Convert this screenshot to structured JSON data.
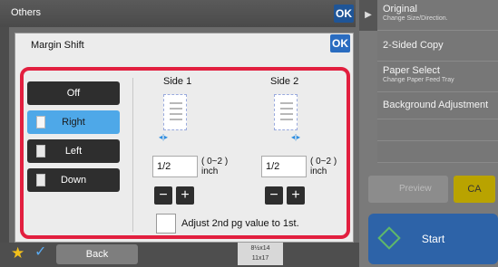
{
  "background": {
    "title": "Others",
    "ok_label": "OK"
  },
  "side_panel": {
    "items": [
      {
        "label": "Original",
        "sub": "Change Size/Direction."
      },
      {
        "label": "2-Sided Copy",
        "sub": ""
      },
      {
        "label": "Paper Select",
        "sub": "Change Paper Feed Tray"
      },
      {
        "label": "Background Adjustment",
        "sub": ""
      }
    ],
    "preview_label": "Preview",
    "ca_label": "CA",
    "start_label": "Start"
  },
  "bottom_bar": {
    "back_label": "Back",
    "paper_line1": "8½x14",
    "paper_line2": "11x17"
  },
  "dialog": {
    "title": "Margin Shift",
    "ok_label": "OK",
    "positions": [
      {
        "label": "Off",
        "selected": false
      },
      {
        "label": "Right",
        "selected": true
      },
      {
        "label": "Left",
        "selected": false
      },
      {
        "label": "Down",
        "selected": false
      }
    ],
    "side1": {
      "label": "Side 1",
      "value": "1/2",
      "range": "( 0~2 )",
      "unit": "inch"
    },
    "side2": {
      "label": "Side 2",
      "value": "1/2",
      "range": "( 0~2 )",
      "unit": "inch"
    },
    "minus_label": "−",
    "plus_label": "+",
    "adjust_label": "Adjust 2nd pg value to 1st.",
    "adjust_checked": false
  },
  "colors": {
    "selected": "#4ea8e8",
    "highlight_frame": "#e21f3f",
    "ok_blue": "#2a6cc0",
    "start_blue": "#2d63a8",
    "ca_yellow": "#b9a300"
  }
}
